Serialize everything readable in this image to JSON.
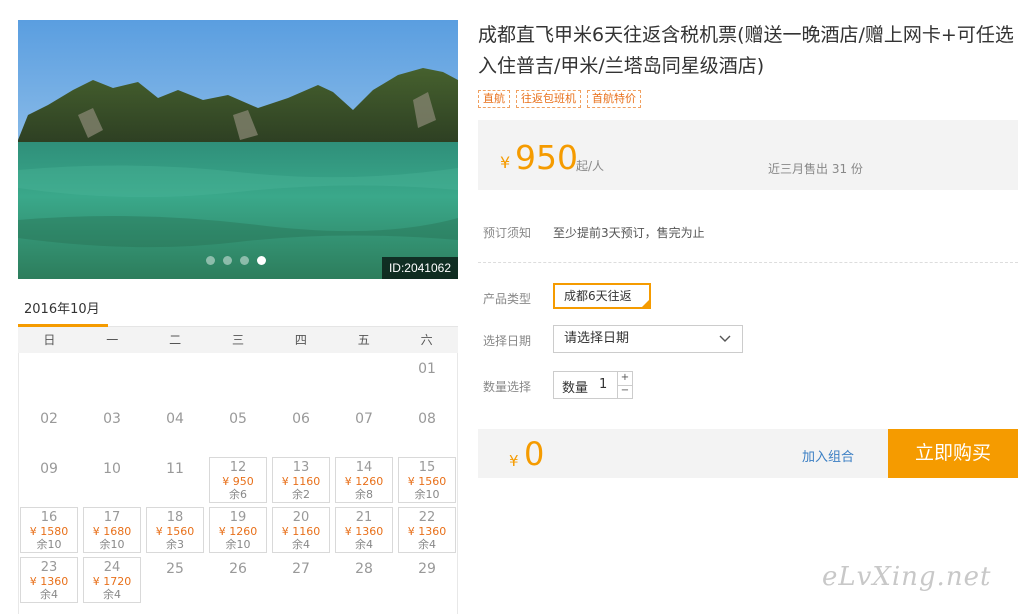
{
  "hero": {
    "image_id": "ID:2041062",
    "dots_count": 4,
    "active_dot": 3
  },
  "calendar": {
    "month_label": "2016年10月",
    "weekdays": [
      "日",
      "一",
      "二",
      "三",
      "四",
      "五",
      "六"
    ],
    "days": [
      {
        "d": "01",
        "col": 6,
        "row": 0
      },
      {
        "d": "02",
        "col": 0,
        "row": 1
      },
      {
        "d": "03",
        "col": 1,
        "row": 1
      },
      {
        "d": "04",
        "col": 2,
        "row": 1
      },
      {
        "d": "05",
        "col": 3,
        "row": 1
      },
      {
        "d": "06",
        "col": 4,
        "row": 1
      },
      {
        "d": "07",
        "col": 5,
        "row": 1
      },
      {
        "d": "08",
        "col": 6,
        "row": 1
      },
      {
        "d": "09",
        "col": 0,
        "row": 2
      },
      {
        "d": "10",
        "col": 1,
        "row": 2
      },
      {
        "d": "11",
        "col": 2,
        "row": 2
      },
      {
        "d": "12",
        "col": 3,
        "row": 2,
        "price": "¥ 950",
        "stock": "余6"
      },
      {
        "d": "13",
        "col": 4,
        "row": 2,
        "price": "¥ 1160",
        "stock": "余2"
      },
      {
        "d": "14",
        "col": 5,
        "row": 2,
        "price": "¥ 1260",
        "stock": "余8"
      },
      {
        "d": "15",
        "col": 6,
        "row": 2,
        "price": "¥ 1560",
        "stock": "余10"
      },
      {
        "d": "16",
        "col": 0,
        "row": 3,
        "price": "¥ 1580",
        "stock": "余10"
      },
      {
        "d": "17",
        "col": 1,
        "row": 3,
        "price": "¥ 1680",
        "stock": "余10"
      },
      {
        "d": "18",
        "col": 2,
        "row": 3,
        "price": "¥ 1560",
        "stock": "余3"
      },
      {
        "d": "19",
        "col": 3,
        "row": 3,
        "price": "¥ 1260",
        "stock": "余10"
      },
      {
        "d": "20",
        "col": 4,
        "row": 3,
        "price": "¥ 1160",
        "stock": "余4"
      },
      {
        "d": "21",
        "col": 5,
        "row": 3,
        "price": "¥ 1360",
        "stock": "余4"
      },
      {
        "d": "22",
        "col": 6,
        "row": 3,
        "price": "¥ 1360",
        "stock": "余4"
      },
      {
        "d": "23",
        "col": 0,
        "row": 4,
        "price": "¥ 1360",
        "stock": "余4"
      },
      {
        "d": "24",
        "col": 1,
        "row": 4,
        "price": "¥ 1720",
        "stock": "余4"
      },
      {
        "d": "25",
        "col": 2,
        "row": 4
      },
      {
        "d": "26",
        "col": 3,
        "row": 4
      },
      {
        "d": "27",
        "col": 4,
        "row": 4
      },
      {
        "d": "28",
        "col": 5,
        "row": 4
      },
      {
        "d": "29",
        "col": 6,
        "row": 4
      }
    ]
  },
  "product": {
    "title": "成都直飞甲米6天往返含税机票(赠送一晚酒店/赠上网卡+可任选入住普吉/甲米/兰塔岛同星级酒店)",
    "tags": [
      "直航",
      "往返包班机",
      "首航特价"
    ],
    "price_symbol": "¥",
    "price": "950",
    "price_unit": "起/人",
    "sold_text": "近三月售出 31 份"
  },
  "booking": {
    "notice_label": "预订须知",
    "notice_text": "至少提前3天预订，售完为止",
    "type_label": "产品类型",
    "type_value": "成都6天往返",
    "date_label": "选择日期",
    "date_placeholder": "请选择日期",
    "qty_label": "数量选择",
    "qty_inner_label": "数量",
    "qty_value": "1",
    "qty_up": "+",
    "qty_down": "−"
  },
  "checkout": {
    "symbol": "¥",
    "total": "0",
    "combo_label": "加入组合",
    "buy_label": "立即购买"
  },
  "watermark": "eLvXing.net",
  "colors": {
    "accent": "#f59b00",
    "price_text": "#e8701a",
    "link": "#3b7fc4"
  }
}
